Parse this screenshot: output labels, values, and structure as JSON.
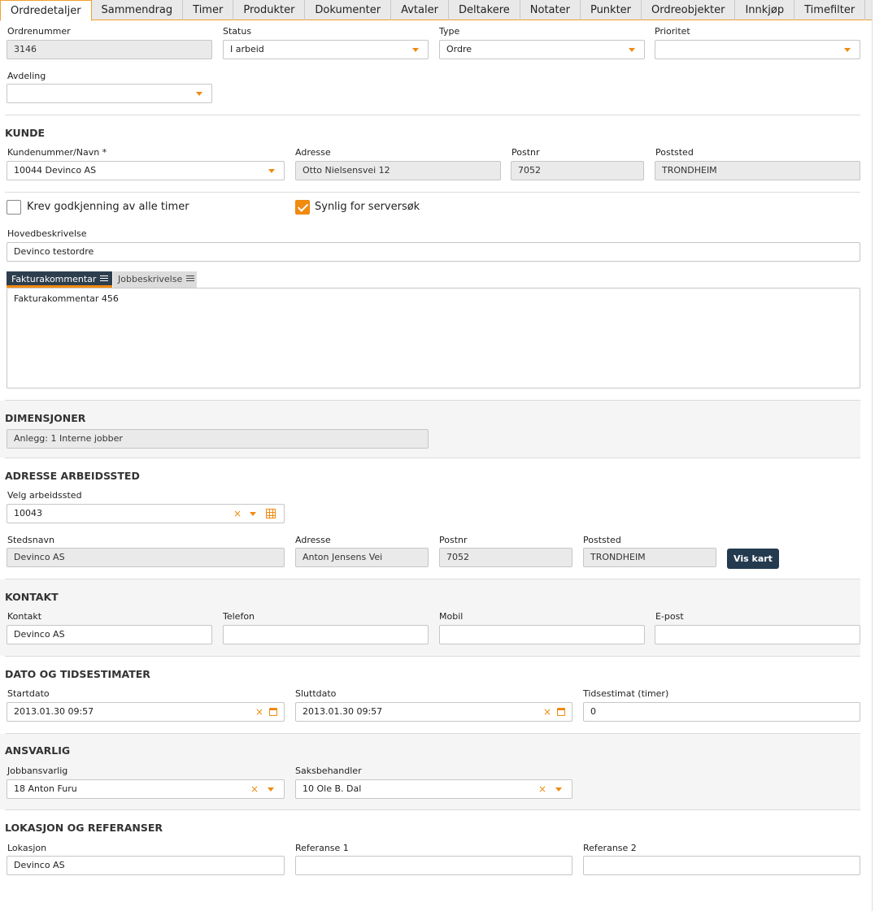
{
  "tabs": [
    "Ordredetaljer",
    "Sammendrag",
    "Timer",
    "Produkter",
    "Dokumenter",
    "Avtaler",
    "Deltakere",
    "Notater",
    "Punkter",
    "Ordreobjekter",
    "Innkjøp",
    "Timefilter"
  ],
  "order": {
    "ordrenummer_label": "Ordrenummer",
    "ordrenummer": "3146",
    "status_label": "Status",
    "status": "I arbeid",
    "type_label": "Type",
    "type": "Ordre",
    "prioritet_label": "Prioritet",
    "prioritet": "",
    "avdeling_label": "Avdeling",
    "avdeling": ""
  },
  "kunde": {
    "title": "KUNDE",
    "kunde_label": "Kundenummer/Navn *",
    "kunde": "10044 Devinco AS",
    "adresse_label": "Adresse",
    "adresse": "Otto Nielsensvei 12",
    "postnr_label": "Postnr",
    "postnr": "7052",
    "poststed_label": "Poststed",
    "poststed": "TRONDHEIM"
  },
  "options": {
    "krev_label": "Krev godkjenning av alle timer",
    "krev_checked": false,
    "synlig_label": "Synlig for serversøk",
    "synlig_checked": true
  },
  "beskrivelse": {
    "hoved_label": "Hovedbeskrivelse",
    "hoved": "Devinco testordre",
    "tab_faktura": "Fakturakommentar",
    "tab_jobb": "Jobbeskrivelse",
    "faktura_text": "Fakturakommentar 456"
  },
  "dimensjoner": {
    "title": "DIMENSJONER",
    "anlegg": "Anlegg: 1 Interne jobber"
  },
  "arbeidssted": {
    "title": "ADRESSE ARBEIDSSTED",
    "velg_label": "Velg arbeidssted",
    "velg": "10043",
    "stedsnavn_label": "Stedsnavn",
    "stedsnavn": "Devinco AS",
    "adresse_label": "Adresse",
    "adresse": "Anton Jensens Vei",
    "postnr_label": "Postnr",
    "postnr": "7052",
    "poststed_label": "Poststed",
    "poststed": "TRONDHEIM",
    "vis_kart": "Vis kart"
  },
  "kontakt": {
    "title": "KONTAKT",
    "kontakt_label": "Kontakt",
    "kontakt": "Devinco AS",
    "telefon_label": "Telefon",
    "telefon": "",
    "mobil_label": "Mobil",
    "mobil": "",
    "epost_label": "E-post",
    "epost": ""
  },
  "dato": {
    "title": "DATO OG TIDSESTIMATER",
    "start_label": "Startdato",
    "start": "2013.01.30 09:57",
    "slutt_label": "Sluttdato",
    "slutt": "2013.01.30 09:57",
    "estimat_label": "Tidsestimat (timer)",
    "estimat": "0"
  },
  "ansvarlig": {
    "title": "ANSVARLIG",
    "jobb_label": "Jobbansvarlig",
    "jobb": "18 Anton Furu",
    "saks_label": "Saksbehandler",
    "saks": "10 Ole B. Dal"
  },
  "lokasjon": {
    "title": "LOKASJON OG REFERANSER",
    "lok_label": "Lokasjon",
    "lok": "Devinco AS",
    "ref1_label": "Referanse 1",
    "ref1": "",
    "ref2_label": "Referanse 2",
    "ref2": ""
  },
  "colors": {
    "accent": "#f08a10",
    "button": "#243b4f",
    "readonly": "#eaeaea"
  }
}
